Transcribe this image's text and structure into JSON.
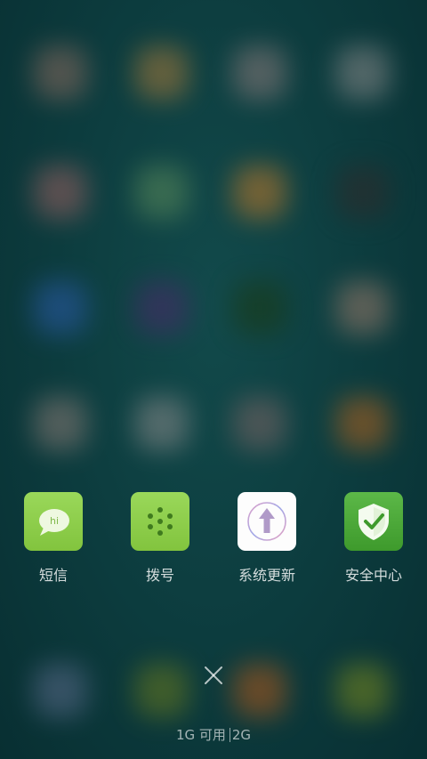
{
  "recent_apps": [
    {
      "label": "短信",
      "icon": "sms-bubble-icon",
      "color": "#8fd14f"
    },
    {
      "label": "拨号",
      "icon": "dialpad-icon",
      "color": "#8fd14f"
    },
    {
      "label": "系统更新",
      "icon": "system-update-arrow-icon",
      "color": "#ffffff"
    },
    {
      "label": "安全中心",
      "icon": "security-shield-check-icon",
      "color": "#4bab3b"
    }
  ],
  "sms_icon_text": "hi",
  "memory": {
    "available": "1G 可用",
    "total": "2G"
  },
  "close_icon": "close-x-icon"
}
